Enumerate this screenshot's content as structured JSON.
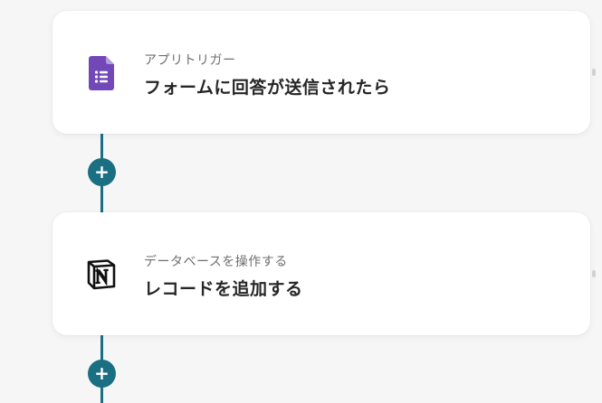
{
  "steps": [
    {
      "subtitle": "アプリトリガー",
      "title": "フォームに回答が送信されたら",
      "icon": "google-forms-icon",
      "icon_color": "#7248b9"
    },
    {
      "subtitle": "データベースを操作する",
      "title": "レコードを追加する",
      "icon": "notion-icon",
      "icon_color": "#111111"
    }
  ],
  "add_button_symbol": "+",
  "colors": {
    "background": "#f6f6f7",
    "card": "#ffffff",
    "connector": "#1a6f83",
    "subtitle": "#6f6f6f",
    "title": "#262626"
  }
}
